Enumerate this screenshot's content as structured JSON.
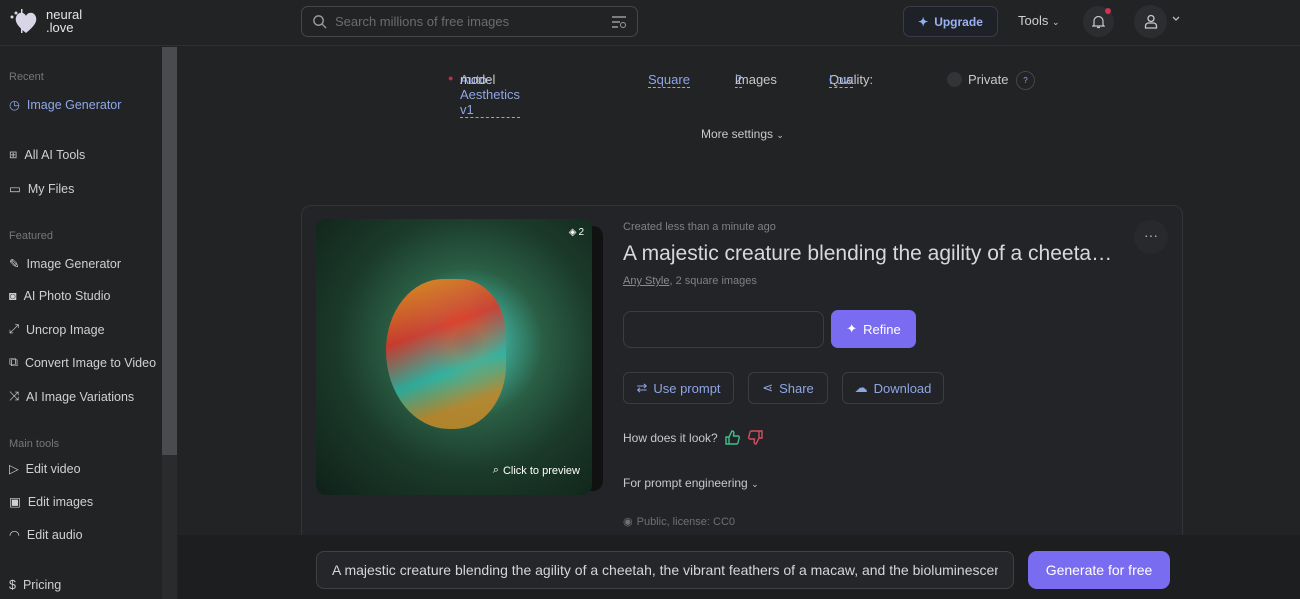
{
  "header": {
    "logo_line1": "neural",
    "logo_line2": ".love",
    "search_placeholder": "Search millions of free images",
    "upgrade": "Upgrade",
    "tools": "Tools"
  },
  "sidebar": {
    "recent_label": "Recent",
    "recent_item": "Image Generator",
    "nav": [
      {
        "label": "All AI Tools",
        "icon": "grid-icon"
      },
      {
        "label": "My Files",
        "icon": "folder-icon"
      }
    ],
    "featured_label": "Featured",
    "featured": [
      {
        "label": "Image Generator",
        "icon": "brush-icon"
      },
      {
        "label": "AI Photo Studio",
        "icon": "camera-icon"
      },
      {
        "label": "Uncrop Image",
        "icon": "expand-icon"
      },
      {
        "label": "Convert Image to Video",
        "icon": "convert-icon"
      },
      {
        "label": "AI Image Variations",
        "icon": "shuffle-icon"
      }
    ],
    "main_label": "Main tools",
    "main": [
      {
        "label": "Edit video",
        "icon": "play-icon"
      },
      {
        "label": "Edit images",
        "icon": "image-icon"
      },
      {
        "label": "Edit audio",
        "icon": "headphones-icon"
      }
    ],
    "pricing": "Pricing"
  },
  "options": {
    "model": "Auto-Aesthetics v1",
    "model_suffix": "model",
    "aspect": "Square",
    "count": "2",
    "count_suffix": "images",
    "quality_label": "Quality:",
    "quality": "Low",
    "private": "Private",
    "help": "?",
    "more": "More settings"
  },
  "result": {
    "layers_count": "2",
    "preview": "Click to preview",
    "created": "Created less than a minute ago",
    "title": "A majestic creature blending the agility of a cheeta…",
    "style": "Any Style",
    "style_suffix": ", 2 square images",
    "refine": "Refine",
    "use_prompt": "Use prompt",
    "share": "Share",
    "download": "Download",
    "how": "How does it look?",
    "prompt_eng": "For prompt engineering",
    "public": "Public, license: CC0",
    "more": "···"
  },
  "bottom": {
    "prompt": "A majestic creature blending the agility of a cheetah, the vibrant feathers of a macaw, and the bioluminescent",
    "generate": "Generate for free"
  },
  "colors": {
    "accent": "#7a6cf0",
    "link": "#8ea6e6",
    "background": "#222325"
  }
}
